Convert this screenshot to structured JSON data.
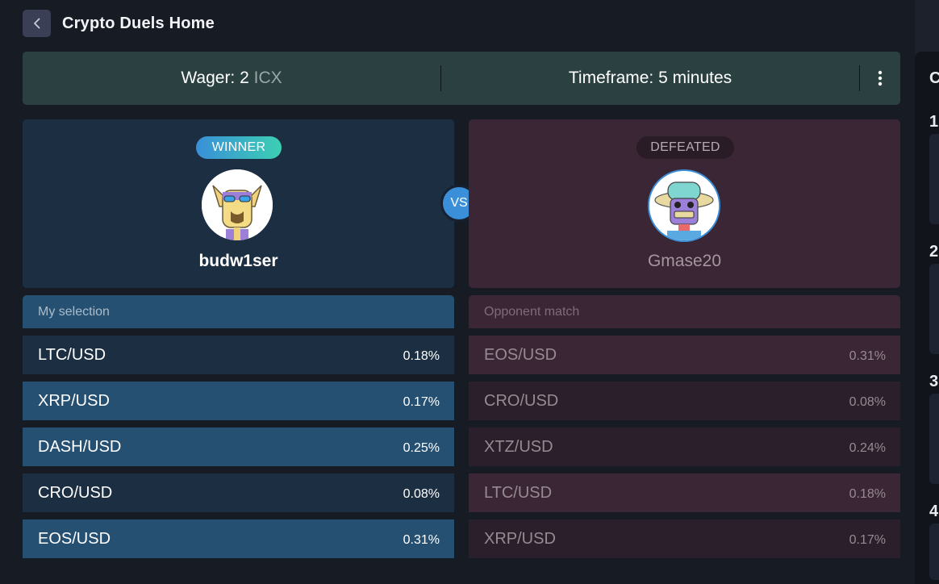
{
  "header": {
    "title": "Crypto Duels Home"
  },
  "wager": {
    "label": "Wager: 2",
    "unit": "ICX"
  },
  "timeframe": {
    "label": "Timeframe: 5 minutes"
  },
  "vs_label": "VS",
  "player": {
    "badge": "WINNER",
    "name": "budw1ser"
  },
  "opponent": {
    "badge": "DEFEATED",
    "name": "Gmase20"
  },
  "my_selection": {
    "header": "My selection",
    "rows": [
      {
        "pair": "LTC/USD",
        "pct": "0.18%"
      },
      {
        "pair": "XRP/USD",
        "pct": "0.17%"
      },
      {
        "pair": "DASH/USD",
        "pct": "0.25%"
      },
      {
        "pair": "CRO/USD",
        "pct": "0.08%"
      },
      {
        "pair": "EOS/USD",
        "pct": "0.31%"
      }
    ]
  },
  "opponent_match": {
    "header": "Opponent match",
    "rows": [
      {
        "pair": "EOS/USD",
        "pct": "0.31%"
      },
      {
        "pair": "CRO/USD",
        "pct": "0.08%"
      },
      {
        "pair": "XTZ/USD",
        "pct": "0.24%"
      },
      {
        "pair": "LTC/USD",
        "pct": "0.18%"
      },
      {
        "pair": "XRP/USD",
        "pct": "0.17%"
      }
    ]
  },
  "side_panel": {
    "heading": "C",
    "numbers": [
      "1.",
      "2",
      "3",
      "4"
    ]
  },
  "colors": {
    "background": "#171b23",
    "infobar": "#2b4141",
    "player_card": "#1c2f42",
    "opponent_card": "#3a2634",
    "accent_blue": "#3a8fd8",
    "accent_teal": "#3ccfb3"
  },
  "icons": {
    "back": "chevron-left-icon",
    "menu": "kebab-menu-icon"
  }
}
